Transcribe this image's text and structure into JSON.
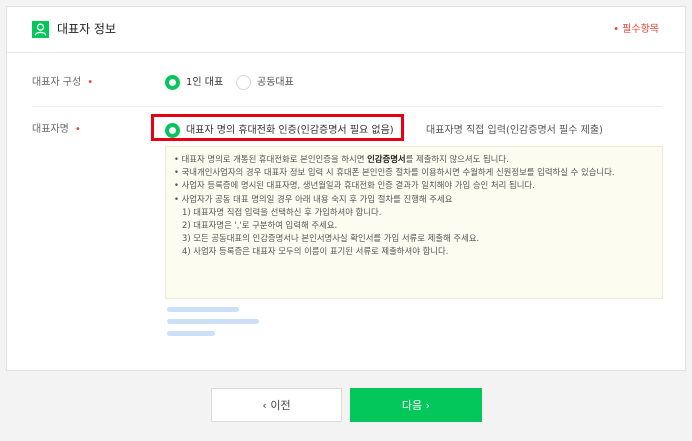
{
  "header": {
    "title": "대표자 정보",
    "required_note": "• 필수항목"
  },
  "rep_type": {
    "label": "대표자 구성",
    "options": [
      {
        "label": "1인 대표",
        "selected": true
      },
      {
        "label": "공동대표",
        "selected": false
      }
    ]
  },
  "rep_name": {
    "label": "대표자명",
    "options": [
      {
        "label": "대표자 명의 휴대전화 인증(인감증명서 필요 없음)",
        "selected": true
      },
      {
        "label": "대표자명 직접 입력(인감증명서 필수 제출)",
        "selected": false
      }
    ]
  },
  "notice": {
    "line1_pre": "• 대표자 명의로 개통된 휴대전화로 본인인증을 하시면 ",
    "line1_bold": "인감증명서",
    "line1_post": "를 제출하지 않으셔도 됩니다.",
    "line2": "• 국내개인사업자의 경우 대표자 정보 입력 시 휴대폰 본인인증 절차를 이용하시면 수월하게 신원정보를 입력하실 수 있습니다.",
    "line3": "• 사업자 등록증에 명시된 대표자명, 생년월일과 휴대전화 인증 결과가 일치해야 가입 승인 처리 됩니다.",
    "line4": "• 사업자가 공동 대표 명의일 경우 아래 내용 숙지 후 가입 절차를 진행해 주세요",
    "sub": [
      "1) 대표자명 직접 입력을 선택하신 후 가입하셔야 합니다.",
      "2) 대표자명은 ','로 구분하여 입력해 주세요.",
      "3) 모든 공동대표의 인감증명서나 본인서명사실 확인서를 가입 서류로 제출해 주세요.",
      "4) 사업자 등록증은 대표자 모두의 이름이 표기된 서류로 제출하셔야 합니다."
    ]
  },
  "buttons": {
    "prev": "이전",
    "next": "다음"
  },
  "icons": {
    "prev": "chevron-left-icon",
    "next": "chevron-right-icon",
    "header": "user-icon"
  },
  "colors": {
    "accent": "#03c75a",
    "required": "#ea4335",
    "highlight": "#e60012"
  }
}
